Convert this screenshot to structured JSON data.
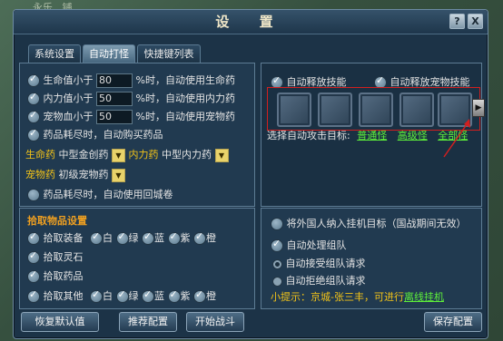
{
  "background_text": "永乐...铺",
  "window": {
    "title": "设 置",
    "help_label": "?",
    "close_label": "X"
  },
  "tabs": [
    {
      "label": "系统设置"
    },
    {
      "label": "自动打怪"
    },
    {
      "label": "快捷键列表"
    }
  ],
  "active_tab": "自动打怪",
  "left": {
    "health": {
      "label": "生命值小于",
      "value": "80",
      "suffix": "%时，自动使用生命药"
    },
    "mana": {
      "label": "内力值小于",
      "value": "50",
      "suffix": "%时，自动使用内力药"
    },
    "pet": {
      "label": "宠物血小于",
      "value": "50",
      "suffix": "%时，自动使用宠物药"
    },
    "buy_potion": "药品耗尽时，自动购买药品",
    "life_potion_label": "生命药",
    "life_potion_value": "中型金创药",
    "mana_potion_label": "内力药",
    "mana_potion_value": "中型内力药",
    "pet_potion_label": "宠物药",
    "pet_potion_value": "初级宠物药",
    "return_scroll": "药品耗尽时，自动使用回城卷"
  },
  "pickup": {
    "title": "拾取物品设置",
    "equip_label": "拾取装备",
    "colors": [
      "白",
      "绿",
      "蓝",
      "紫",
      "橙"
    ],
    "spirit_label": "拾取灵石",
    "potion_label": "拾取药品",
    "other_label": "拾取其他"
  },
  "right_top": {
    "auto_skill": "自动释放技能",
    "auto_pet_skill": "自动释放宠物技能",
    "next_label": "▶",
    "target_label": "选择自动攻击目标:",
    "target_normal": "普通怪",
    "target_elite": "高级怪",
    "target_all": "全部怪"
  },
  "right_bottom": {
    "foreign": "将外国人纳入挂机目标（国战期间无效）",
    "team": "自动处理组队",
    "accept": "自动接受组队请求",
    "reject": "自动拒绝组队请求",
    "tip_prefix": "小提示：京城-张三丰，可进行",
    "tip_link": "离线挂机"
  },
  "buttons": {
    "restore": "恢复默认值",
    "recommend": "推荐配置",
    "start": "开始战斗",
    "save": "保存配置"
  },
  "colors": {
    "accent_yellow": "#f2c318",
    "pickup_title": "#f0a020",
    "link_green": "#5ef03a",
    "highlight_red": "#d11f1f"
  }
}
